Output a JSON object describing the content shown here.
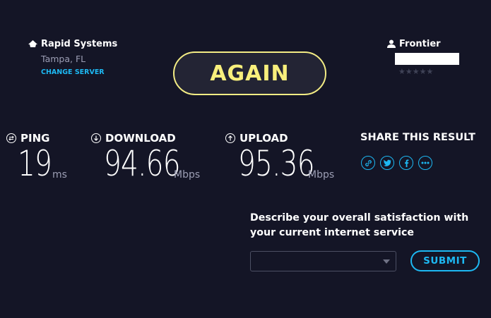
{
  "server": {
    "name": "Rapid Systems",
    "location": "Tampa, FL",
    "change_label": "CHANGE SERVER"
  },
  "isp": {
    "name": "Frontier",
    "rating_stars": "★★★★★"
  },
  "again_label": "AGAIN",
  "metrics": {
    "ping": {
      "label": "PING",
      "value": "19",
      "unit": "ms"
    },
    "download": {
      "label": "DOWNLOAD",
      "value": "94.66",
      "unit": "Mbps"
    },
    "upload": {
      "label": "UPLOAD",
      "value": "95.36",
      "unit": "Mbps"
    }
  },
  "share": {
    "title": "SHARE THIS RESULT",
    "icons": [
      "link-icon",
      "twitter-icon",
      "facebook-icon",
      "more-icon"
    ]
  },
  "survey": {
    "question": "Describe your overall satisfaction with your current internet service",
    "selected": "",
    "submit_label": "SUBMIT"
  },
  "colors": {
    "background": "#141526",
    "accent_yellow": "#f8ef7c",
    "accent_blue": "#1db8f2",
    "muted": "#9c9eb4"
  }
}
